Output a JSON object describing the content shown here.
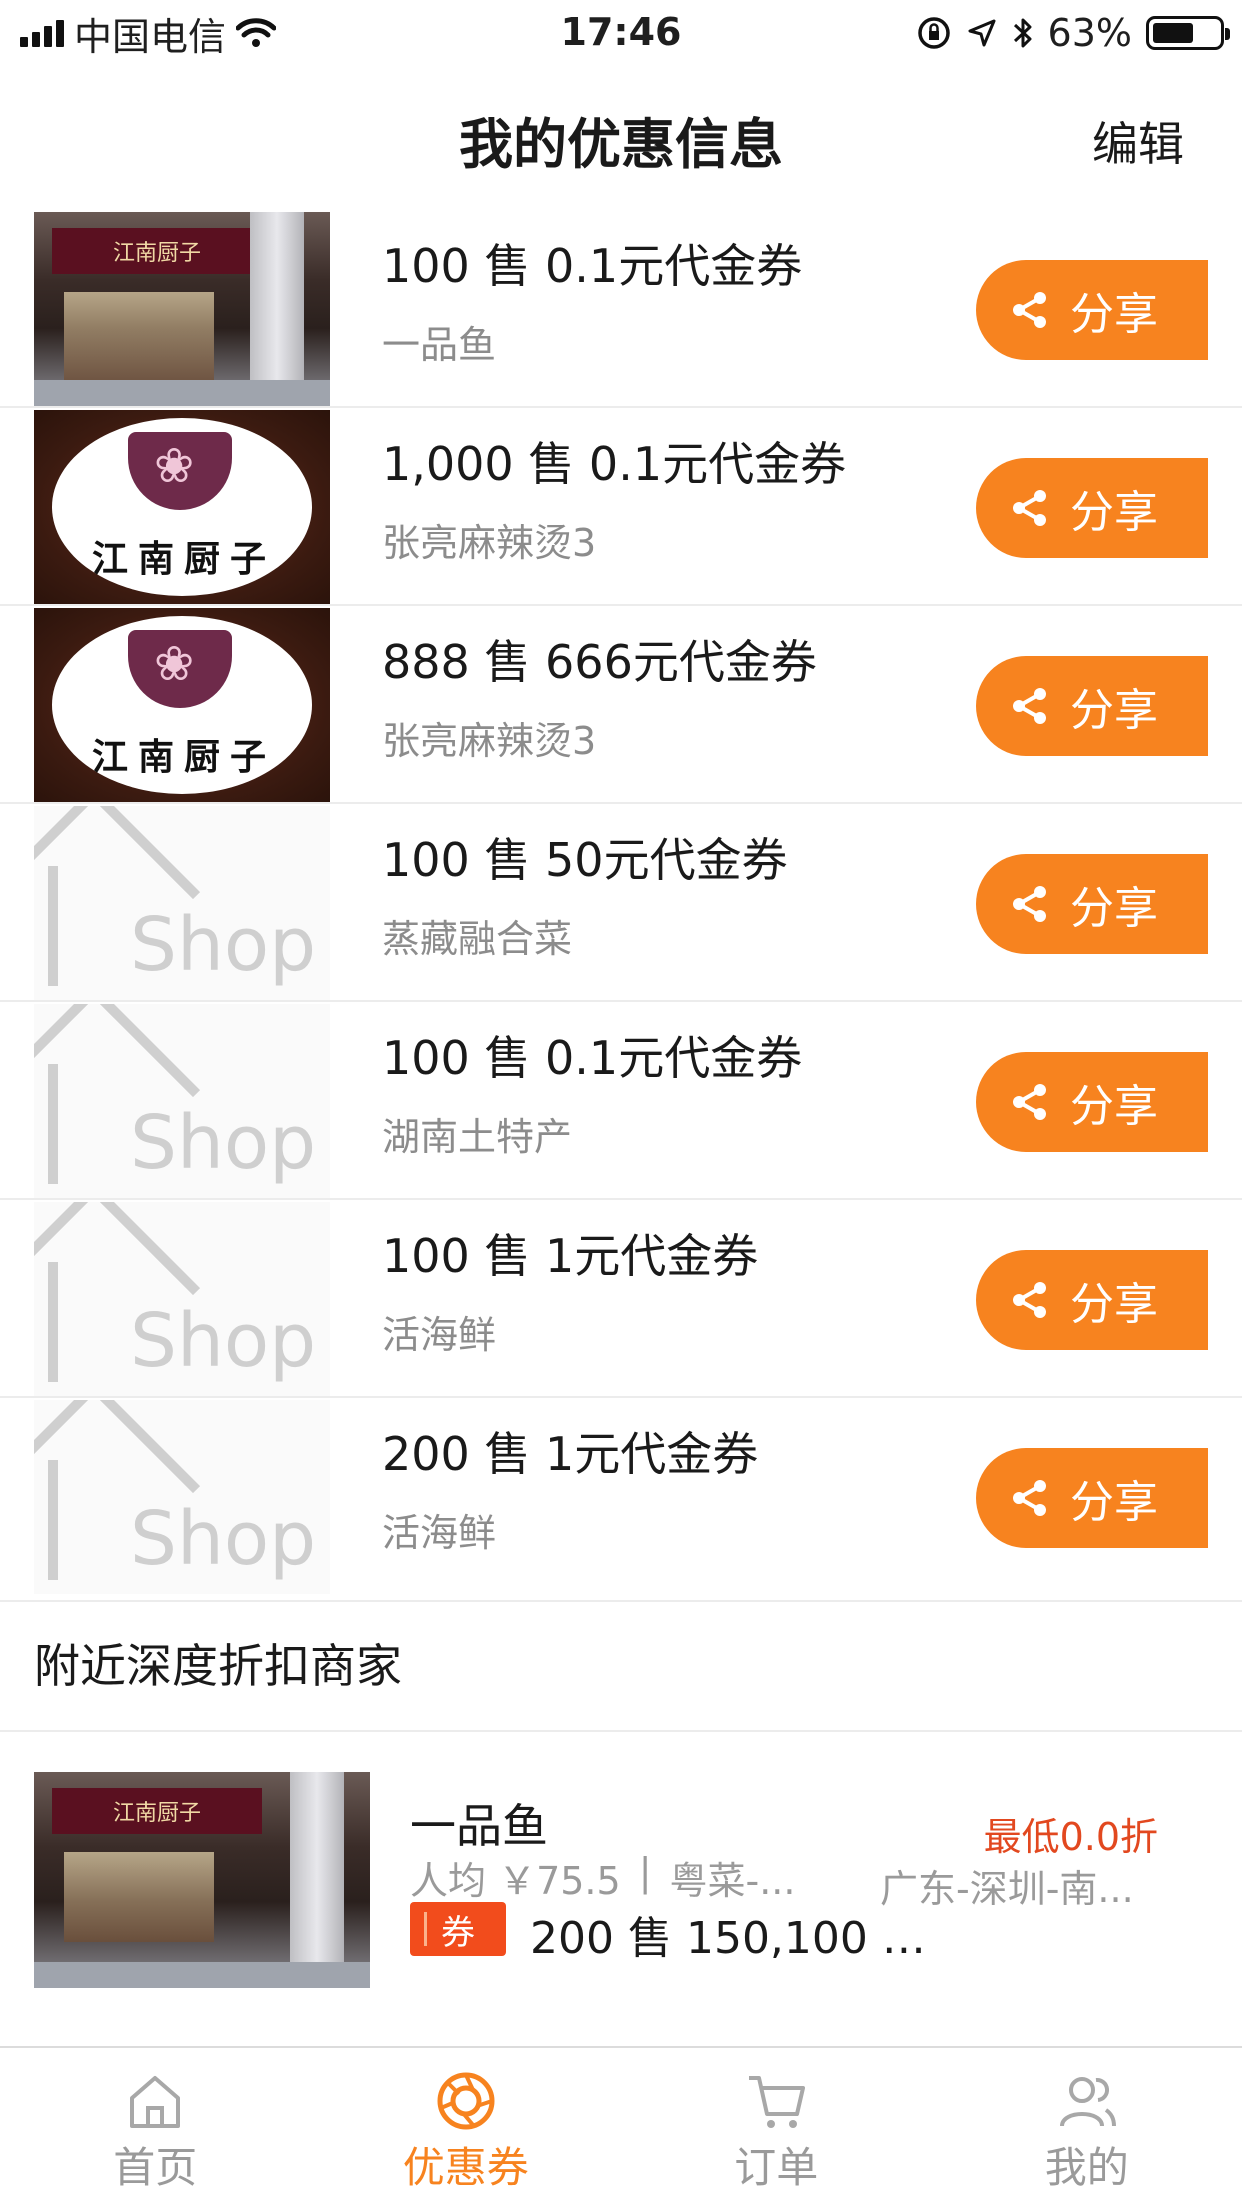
{
  "status_bar": {
    "carrier": "中国电信",
    "time": "17:46",
    "battery": "63%"
  },
  "header": {
    "title": "我的优惠信息",
    "edit_label": "编辑"
  },
  "share_label": "分享",
  "coupons": [
    {
      "title": "100 售 0.1元代金券",
      "shop": "一品鱼",
      "thumb": "store-photo"
    },
    {
      "title": "1,000 售 0.1元代金券",
      "shop": "张亮麻辣烫3",
      "thumb": "restaurant-logo"
    },
    {
      "title": "888 售 666元代金券",
      "shop": "张亮麻辣烫3",
      "thumb": "restaurant-logo"
    },
    {
      "title": "100 售 50元代金券",
      "shop": "蒸藏融合菜",
      "thumb": "shop-placeholder"
    },
    {
      "title": "100 售 0.1元代金券",
      "shop": "湖南土特产",
      "thumb": "shop-placeholder"
    },
    {
      "title": "100 售 1元代金券",
      "shop": "活海鲜",
      "thumb": "shop-placeholder"
    },
    {
      "title": "200 售 1元代金券",
      "shop": "活海鲜",
      "thumb": "shop-placeholder"
    }
  ],
  "thumb_text": {
    "store_sign": "江南厨子",
    "logo_text": "江南厨子",
    "placeholder": "Shop"
  },
  "nearby": {
    "section_title": "附近深度折扣商家",
    "merchant": {
      "name": "一品鱼",
      "discount": "最低0.0折",
      "avg_price": "人均 ￥75.5",
      "separator": "|",
      "cuisine": "粤菜-...",
      "area": "广东-深圳-南...",
      "voucher_tag": "券",
      "deals": "200 售 150,100 售..."
    }
  },
  "tabs": [
    {
      "label": "首页",
      "icon": "home-icon",
      "active": false
    },
    {
      "label": "优惠券",
      "icon": "coupon-icon",
      "active": true
    },
    {
      "label": "订单",
      "icon": "cart-icon",
      "active": false
    },
    {
      "label": "我的",
      "icon": "user-icon",
      "active": false
    }
  ],
  "colors": {
    "accent": "#f7831f",
    "discount_red": "#e2481f",
    "voucher_red": "#f24c1c"
  }
}
